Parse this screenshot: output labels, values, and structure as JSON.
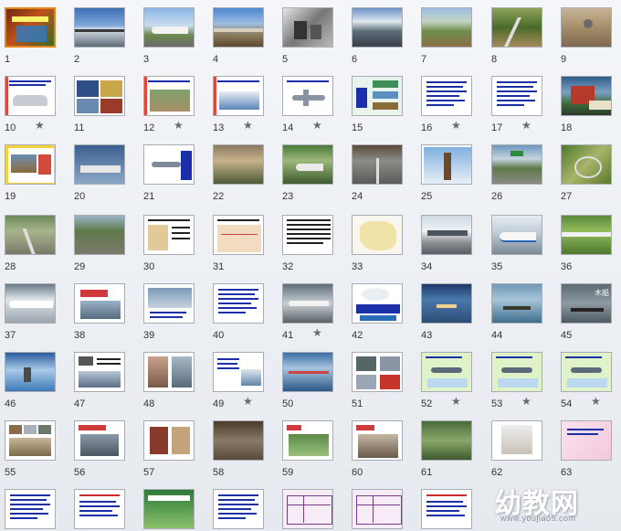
{
  "view": "slide-sorter",
  "selected_slide": "1",
  "animation_icon": "star-icon",
  "slides": [
    {
      "n": "1",
      "theme": "title",
      "star": false
    },
    {
      "n": "2",
      "theme": "photo-railbridge",
      "star": false
    },
    {
      "n": "3",
      "theme": "photo-train-white",
      "star": false
    },
    {
      "n": "4",
      "theme": "photo-viaduct",
      "star": false
    },
    {
      "n": "5",
      "theme": "photo-bw",
      "star": false
    },
    {
      "n": "6",
      "theme": "photo-mountain",
      "star": false
    },
    {
      "n": "7",
      "theme": "photo-landscape",
      "star": false
    },
    {
      "n": "8",
      "theme": "photo-road-green",
      "star": false
    },
    {
      "n": "9",
      "theme": "photo-road-tan",
      "star": false
    },
    {
      "n": "10",
      "theme": "doc-car",
      "star": true
    },
    {
      "n": "11",
      "theme": "doc-buses",
      "star": false
    },
    {
      "n": "12",
      "theme": "doc-rail",
      "star": true
    },
    {
      "n": "13",
      "theme": "doc-ship",
      "star": true
    },
    {
      "n": "14",
      "theme": "doc-plane",
      "star": true
    },
    {
      "n": "15",
      "theme": "doc-diagram",
      "star": false
    },
    {
      "n": "16",
      "theme": "doc-text",
      "star": true
    },
    {
      "n": "17",
      "theme": "doc-text",
      "star": true
    },
    {
      "n": "18",
      "theme": "photo-train-red",
      "star": false
    },
    {
      "n": "19",
      "theme": "doc-frame",
      "star": false
    },
    {
      "n": "20",
      "theme": "doc-cargo",
      "star": false
    },
    {
      "n": "21",
      "theme": "doc-plane2",
      "star": false
    },
    {
      "n": "22",
      "theme": "photo-rural",
      "star": false
    },
    {
      "n": "23",
      "theme": "photo-highspeed",
      "star": false
    },
    {
      "n": "24",
      "theme": "photo-road-gray",
      "star": false
    },
    {
      "n": "25",
      "theme": "doc-tower",
      "star": false
    },
    {
      "n": "26",
      "theme": "photo-highway",
      "star": false
    },
    {
      "n": "27",
      "theme": "photo-interchange",
      "star": false
    },
    {
      "n": "28",
      "theme": "photo-road-mountain",
      "star": false
    },
    {
      "n": "29",
      "theme": "photo-road-curve",
      "star": false
    },
    {
      "n": "30",
      "theme": "doc-map-text",
      "star": false
    },
    {
      "n": "31",
      "theme": "doc-map",
      "star": false
    },
    {
      "n": "32",
      "theme": "doc-dense-text",
      "star": false
    },
    {
      "n": "33",
      "theme": "doc-map2",
      "star": false
    },
    {
      "n": "34",
      "theme": "photo-station",
      "star": false
    },
    {
      "n": "35",
      "theme": "photo-bullet",
      "star": false
    },
    {
      "n": "36",
      "theme": "photo-train-field",
      "star": false
    },
    {
      "n": "37",
      "theme": "photo-train-speed",
      "star": false
    },
    {
      "n": "38",
      "theme": "doc-badge",
      "star": false
    },
    {
      "n": "39",
      "theme": "doc-maglev",
      "star": false
    },
    {
      "n": "40",
      "theme": "doc-text",
      "star": false
    },
    {
      "n": "41",
      "theme": "doc-maglev2",
      "star": true
    },
    {
      "n": "42",
      "theme": "doc-cartoon",
      "star": false
    },
    {
      "n": "43",
      "theme": "photo-river",
      "star": false
    },
    {
      "n": "44",
      "theme": "photo-boat",
      "star": false
    },
    {
      "n": "45",
      "theme": "photo-wooden-boat",
      "star": false
    },
    {
      "n": "46",
      "theme": "photo-lake",
      "star": false
    },
    {
      "n": "47",
      "theme": "doc-ship-text",
      "star": false
    },
    {
      "n": "48",
      "theme": "doc-port",
      "star": false
    },
    {
      "n": "49",
      "theme": "doc-ship2",
      "star": true
    },
    {
      "n": "50",
      "theme": "photo-dock",
      "star": false
    },
    {
      "n": "51",
      "theme": "doc-plane3",
      "star": false
    },
    {
      "n": "52",
      "theme": "doc-green-plane",
      "star": true
    },
    {
      "n": "53",
      "theme": "doc-green-plane",
      "star": true
    },
    {
      "n": "54",
      "theme": "doc-green-plane",
      "star": true
    },
    {
      "n": "55",
      "theme": "doc-tiles",
      "star": false
    },
    {
      "n": "56",
      "theme": "doc-people",
      "star": false
    },
    {
      "n": "57",
      "theme": "doc-sedan",
      "star": false
    },
    {
      "n": "58",
      "theme": "photo-cart",
      "star": false
    },
    {
      "n": "59",
      "theme": "doc-boat-green",
      "star": false
    },
    {
      "n": "60",
      "theme": "doc-horse",
      "star": false
    },
    {
      "n": "61",
      "theme": "photo-forest",
      "star": false
    },
    {
      "n": "62",
      "theme": "doc-figure",
      "star": false
    },
    {
      "n": "63",
      "theme": "doc-pink",
      "star": false
    },
    {
      "n": "",
      "theme": "doc-text",
      "star": false
    },
    {
      "n": "",
      "theme": "doc-text-red",
      "star": false
    },
    {
      "n": "",
      "theme": "doc-green-banner",
      "star": false
    },
    {
      "n": "",
      "theme": "doc-text",
      "star": false
    },
    {
      "n": "",
      "theme": "doc-table-purple",
      "star": false
    },
    {
      "n": "",
      "theme": "doc-table-purple",
      "star": false
    },
    {
      "n": "",
      "theme": "doc-text-red",
      "star": false
    }
  ],
  "watermark": {
    "main": "幼教网",
    "sub": "www.youjiao5.com",
    "color": "#ffffff"
  }
}
